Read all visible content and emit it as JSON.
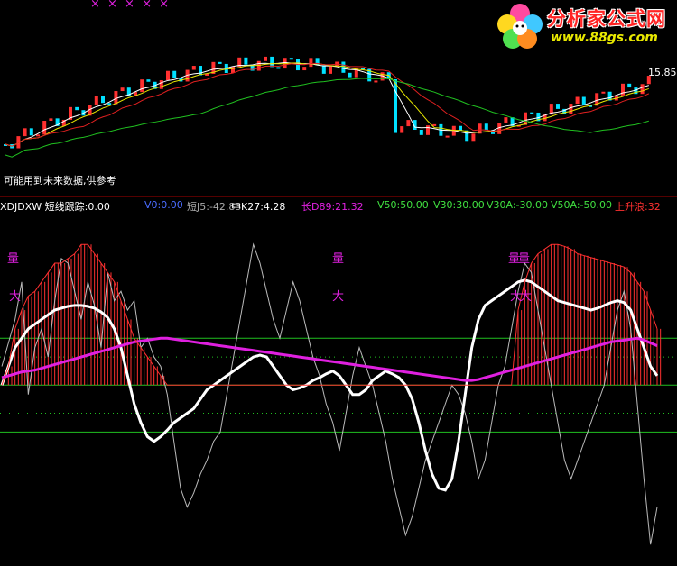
{
  "header": {
    "indicator": {
      "text": "XDJDXW  短线跟踪:0.00",
      "color": "#ffffff"
    },
    "v0": {
      "text": "V0:0.00",
      "color": "#4a6cff"
    },
    "short": {
      "text": "短J5:-42.83",
      "color": "#aaaaaa"
    },
    "mid": {
      "text": "中K27:4.28",
      "color": "#ffffff"
    },
    "long": {
      "text": "长D89:21.32",
      "color": "#e020e0"
    },
    "v50": {
      "text": "V50:50.00",
      "color": "#40e040"
    },
    "v30": {
      "text": "V30:30.00",
      "color": "#40e040"
    },
    "v30a": {
      "text": "V30A:-30.00",
      "color": "#40e040"
    },
    "v50a": {
      "text": "V50A:-50.00",
      "color": "#40e040"
    },
    "rise": {
      "text": "上升浪:32",
      "color": "#ff3030"
    }
  },
  "note": "可能用到未来数据,供参考",
  "price_label": "15.85",
  "logo": {
    "title": "分析家公式网",
    "url": "www.88gs.com"
  },
  "marks": {
    "liang": "量",
    "da": "大"
  },
  "top_markers": "× ×   × ×   ×",
  "colors": {
    "up": "#ff3030",
    "down": "#00e0ff",
    "ma5": "#ffffff",
    "ma10": "#e8e800",
    "ma20": "#e02020",
    "ma60": "#20c020",
    "white_line": "#ffffff",
    "magenta_line": "#e020e0",
    "grid": "#20c020",
    "separator": "#aa0000"
  },
  "chart_data": {
    "type": "line",
    "x": [
      0,
      1,
      2,
      3,
      4,
      5,
      6,
      7,
      8,
      9,
      10,
      11,
      12,
      13,
      14,
      15,
      16,
      17,
      18,
      19,
      20,
      21,
      22,
      23,
      24,
      25,
      26,
      27,
      28,
      29,
      30,
      31,
      32,
      33,
      34,
      35,
      36,
      37,
      38,
      39,
      40,
      41,
      42,
      43,
      44,
      45,
      46,
      47,
      48,
      49,
      50,
      51,
      52,
      53,
      54,
      55,
      56,
      57,
      58,
      59,
      60,
      61,
      62,
      63,
      64,
      65,
      66,
      67,
      68,
      69,
      70,
      71,
      72,
      73,
      74,
      75,
      76,
      77,
      78,
      79,
      80,
      81,
      82,
      83,
      84,
      85,
      86,
      87,
      88,
      89,
      90,
      91,
      92,
      93,
      94,
      95,
      96,
      97,
      98,
      99
    ],
    "series": [
      {
        "name": "短J5",
        "values": [
          20,
          45,
          70,
          110,
          -10,
          40,
          60,
          30,
          90,
          135,
          130,
          100,
          70,
          110,
          85,
          40,
          120,
          90,
          100,
          80,
          90,
          40,
          50,
          30,
          20,
          -10,
          -60,
          -110,
          -130,
          -115,
          -95,
          -80,
          -60,
          -50,
          -10,
          30,
          70,
          110,
          150,
          130,
          100,
          70,
          50,
          80,
          110,
          90,
          60,
          30,
          10,
          -20,
          -40,
          -70,
          -30,
          10,
          40,
          20,
          0,
          -30,
          -60,
          -100,
          -130,
          -160,
          -140,
          -110,
          -80,
          -60,
          -40,
          -20,
          0,
          -10,
          -30,
          -60,
          -100,
          -80,
          -40,
          0,
          20,
          60,
          100,
          130,
          120,
          80,
          40,
          0,
          -40,
          -80,
          -100,
          -80,
          -60,
          -40,
          -20,
          0,
          40,
          80,
          100,
          60,
          -20,
          -100,
          -170,
          -130
        ]
      },
      {
        "name": "中K27",
        "values": [
          0,
          20,
          40,
          50,
          60,
          65,
          70,
          75,
          80,
          82,
          84,
          85,
          85,
          84,
          82,
          78,
          72,
          60,
          40,
          10,
          -20,
          -40,
          -55,
          -60,
          -55,
          -48,
          -40,
          -35,
          -30,
          -25,
          -15,
          -5,
          0,
          5,
          10,
          15,
          20,
          25,
          30,
          32,
          30,
          20,
          10,
          0,
          -5,
          -3,
          0,
          5,
          8,
          12,
          15,
          10,
          0,
          -10,
          -10,
          -5,
          5,
          10,
          15,
          12,
          8,
          0,
          -15,
          -40,
          -70,
          -95,
          -110,
          -112,
          -100,
          -60,
          -10,
          40,
          70,
          85,
          90,
          95,
          100,
          105,
          110,
          112,
          110,
          105,
          100,
          95,
          90,
          88,
          86,
          84,
          82,
          80,
          82,
          85,
          88,
          90,
          88,
          80,
          60,
          40,
          20,
          10
        ]
      },
      {
        "name": "长D89",
        "values": [
          8,
          10,
          12,
          14,
          15,
          16,
          18,
          20,
          22,
          24,
          26,
          28,
          30,
          32,
          34,
          36,
          38,
          40,
          42,
          44,
          46,
          47,
          48,
          49,
          50,
          50,
          49,
          48,
          47,
          46,
          45,
          44,
          43,
          42,
          41,
          40,
          39,
          38,
          37,
          36,
          35,
          34,
          33,
          32,
          31,
          30,
          29,
          28,
          27,
          26,
          25,
          24,
          23,
          22,
          21,
          20,
          19,
          18,
          17,
          16,
          15,
          14,
          13,
          12,
          11,
          10,
          9,
          8,
          7,
          6,
          5,
          5,
          6,
          8,
          10,
          12,
          14,
          16,
          18,
          20,
          22,
          24,
          26,
          28,
          30,
          32,
          34,
          36,
          38,
          40,
          42,
          44,
          46,
          47,
          48,
          49,
          50,
          48,
          45,
          42
        ]
      },
      {
        "name": "上升浪",
        "values": [
          0,
          20,
          60,
          80,
          95,
          100,
          110,
          120,
          130,
          130,
          135,
          140,
          150,
          150,
          140,
          130,
          120,
          110,
          90,
          70,
          50,
          40,
          30,
          20,
          10,
          0,
          0,
          0,
          0,
          0,
          0,
          0,
          0,
          0,
          0,
          0,
          0,
          0,
          0,
          0,
          0,
          0,
          0,
          0,
          0,
          0,
          0,
          0,
          0,
          0,
          0,
          0,
          0,
          0,
          0,
          0,
          0,
          0,
          0,
          0,
          0,
          0,
          0,
          0,
          0,
          0,
          0,
          0,
          0,
          0,
          0,
          0,
          0,
          0,
          0,
          0,
          0,
          0,
          80,
          110,
          130,
          140,
          145,
          150,
          150,
          148,
          145,
          140,
          138,
          136,
          134,
          132,
          130,
          128,
          126,
          120,
          110,
          100,
          80,
          60
        ]
      }
    ],
    "ylim": [
      -190,
      180
    ],
    "reference_lines": [
      50,
      30,
      0,
      -30,
      -50
    ]
  }
}
